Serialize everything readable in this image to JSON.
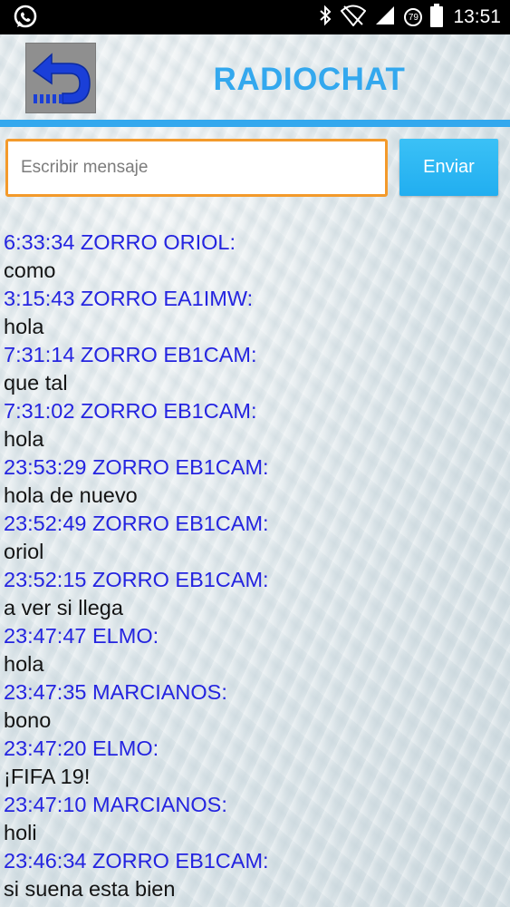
{
  "status_bar": {
    "time": "13:51",
    "battery_badge": "79",
    "icons": [
      "whatsapp-icon",
      "bluetooth-icon",
      "wifi-off-icon",
      "signal-icon",
      "battery-icon"
    ]
  },
  "header": {
    "title": "RADIOCHAT",
    "back_icon": "back-arrow-icon"
  },
  "composer": {
    "placeholder": "Escribir mensaje",
    "value": "",
    "send_label": "Enviar"
  },
  "messages": [
    {
      "header": "6:33:34 ZORRO ORIOL:",
      "text": "como"
    },
    {
      "header": "3:15:43 ZORRO EA1IMW:",
      "text": "hola"
    },
    {
      "header": "7:31:14 ZORRO EB1CAM:",
      "text": "que tal"
    },
    {
      "header": "7:31:02 ZORRO EB1CAM:",
      "text": "hola"
    },
    {
      "header": "23:53:29 ZORRO EB1CAM:",
      "text": "hola de nuevo"
    },
    {
      "header": "23:52:49 ZORRO EB1CAM:",
      "text": "oriol"
    },
    {
      "header": "23:52:15 ZORRO EB1CAM:",
      "text": "a ver si llega"
    },
    {
      "header": "23:47:47 ELMO:",
      "text": "hola"
    },
    {
      "header": "23:47:35 MARCIANOS:",
      "text": "bono"
    },
    {
      "header": "23:47:20 ELMO:",
      "text": "¡FIFA 19!"
    },
    {
      "header": "23:47:10 MARCIANOS:",
      "text": "holi"
    },
    {
      "header": "23:46:34 ZORRO EB1CAM:",
      "text": "si suena esta bien"
    }
  ],
  "colors": {
    "accent": "#33a8ee",
    "input_border": "#f39a2b",
    "message_header": "#2424e0"
  }
}
